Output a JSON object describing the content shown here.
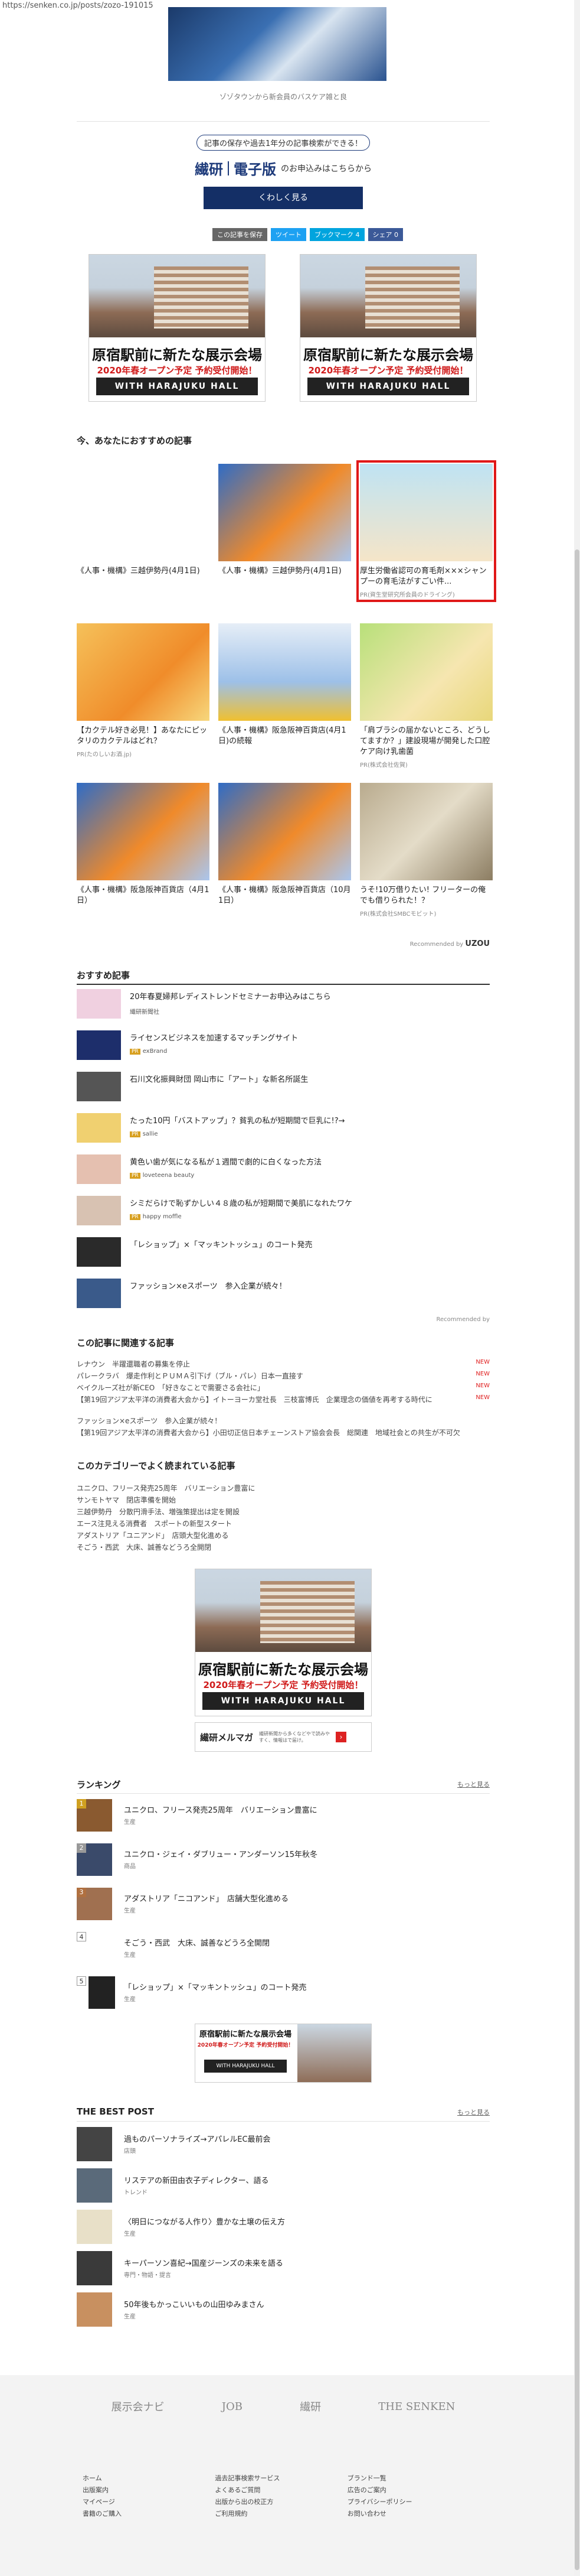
{
  "url": "https://senken.co.jp/posts/zozo-191015",
  "top_caption": "ゾゾタウンから新会員のバスケア雑と良",
  "subscribe": {
    "text": "記事の保存や過去1年分の記事検索ができる！",
    "logo": "繊研",
    "logo2": "電子版",
    "logo_suffix": "のお申込みはこちらから",
    "button": "くわしく見る"
  },
  "share": [
    "この記事を保存",
    "ツイート",
    "ブックマーク 4",
    "シェア 0"
  ],
  "ad": {
    "title": "原宿駅前に新たな展示会場",
    "sub": "2020年春オープン予定 予約受付開始！",
    "footer": "WITH HARAJUKU HALL"
  },
  "recommend_title": "今、あなたにおすすめの記事",
  "cards": [
    {
      "title": "《人事・機構》三越伊勢丹(4月1日)",
      "pr": ""
    },
    {
      "title": "《人事・機構》三越伊勢丹(4月1日)",
      "pr": ""
    },
    {
      "title": "厚生労働省認可の育毛剤×××シャンプーの育毛法がすごい件...",
      "pr": "PR(資生堂研究所会員のドライング)"
    },
    {
      "title": "【カクテル好き必見！】あなたにピッタリのカクテルはどれ？",
      "pr": "PR(たのしいお酒.jp)"
    },
    {
      "title": "《人事・機構》阪急阪神百貨店(4月1日)の続報",
      "pr": ""
    },
    {
      "title": "「肩ブラシの届かないところ、どうしてますか？」建設現場が開発した口腔ケア向け乳歯菌",
      "pr": "PR(株式会社佐賀)"
    },
    {
      "title": "《人事・機構》阪急阪神百貨店（4月1日）",
      "pr": ""
    },
    {
      "title": "《人事・機構》阪急阪神百貨店（10月1日）",
      "pr": ""
    },
    {
      "title": "うそ!10万借りたい! フリーターの俺でも借りられた！？",
      "pr": "PR(株式会社SMBCモビット)"
    }
  ],
  "powered": "Recommended by",
  "uzou": "UZOU",
  "osusume_title": "おすすめ記事",
  "osusume": [
    {
      "title": "20年春夏婦邦レディストレンドセミナーお申込みはこちら",
      "src": "繊研新聞社",
      "pr": false
    },
    {
      "title": "ライセンスビジネスを加速するマッチングサイト",
      "src": "exBrand",
      "pr": true
    },
    {
      "title": "石川文化振興財団 岡山市に「アート」な新名所誕生",
      "src": "",
      "pr": false
    },
    {
      "title": "たった10円「バストアップ」？貧乳の私が短期間で巨乳に!?→",
      "src": "sallie",
      "pr": true
    },
    {
      "title": "黄色い歯が気になる私が１週間で劇的に白くなった方法",
      "src": "loveteena beauty",
      "pr": true
    },
    {
      "title": "シミだらけで恥ずかしい４８歳の私が短期間で美肌になれたワケ",
      "src": "happy moffle",
      "pr": true
    },
    {
      "title": "「レショップ」×「マッキントッシュ」のコート発売",
      "src": "",
      "pr": false
    },
    {
      "title": "ファッション×eスポーツ　参入企業が続々！",
      "src": "",
      "pr": false
    }
  ],
  "recby2": "Recommended by",
  "related_title": "この記事に関連する記事",
  "related": [
    {
      "t": "レナウン　半躍還職者の募集を停止",
      "n": "NEW"
    },
    {
      "t": "パレークラバ　爆走作利とＰＵＭＡ引下げ（ブル・パレ）日本一直接す",
      "n": "NEW"
    },
    {
      "t": "ベイクルーズ社が新CEO　「好きなことで需要さる会社に」",
      "n": "NEW"
    },
    {
      "t": "【第19回アジア太平洋の消費者大会から】イトーヨーカ堂社長　三枝富博氏　企業理念の価値を再考する時代に",
      "n": "NEW"
    },
    {
      "t": "ファッション×eスポーツ　参入企業が続々！",
      "n": ""
    },
    {
      "t": "【第19回アジア太平洋の消費者大会から】小田切正信日本チェーンストア協会会長　総関連　地域社会との共生が不可欠",
      "n": ""
    }
  ],
  "category_title": "このカテゴリーでよく読まれている記事",
  "category": [
    "ユニクロ、フリース発売25周年　バリエーション豊富に",
    "サンモトヤマ　閉店準備を開始",
    "三越伊勢丹　分散円滑手法、増強策提出は定を開設",
    "エース注見える消費者　スポートの新型スタート",
    "アダストリア「ユニアンド」　店頭大型化進める",
    "そごう・西武　大床、誠善などうろ全開閉"
  ],
  "senken_mag": "繊研メルマガ",
  "mag_text": "繊研新聞から多くなどやで読みやすく、情報はで届け。",
  "ranking_title": "ランキング",
  "more": "もっと見る",
  "ranking": [
    {
      "no": "1",
      "t": "ユニクロ、フリース発売25周年　バリエーション豊富に",
      "s": "生産"
    },
    {
      "no": "2",
      "t": "ユニクロ・ジェイ・ダブリュー・アンダーソン15年秋冬",
      "s": "商品"
    },
    {
      "no": "3",
      "t": "アダストリア「ニコアンド」　店舗大型化進める",
      "s": "生産"
    },
    {
      "no": "4",
      "t": "そごう・西武　大床、誠善などうろ全開閉",
      "s": "生産"
    },
    {
      "no": "5",
      "t": "「レショップ」×「マッキントッシュ」のコート発売",
      "s": "生産"
    }
  ],
  "bestpost_title": "THE BEST POST",
  "bestpost": [
    {
      "t": "過ものパーソナライズ→アパレルEC最前会",
      "s": "店頭"
    },
    {
      "t": "リステアの新田由衣子ディレクター、語る",
      "s": "トレンド"
    },
    {
      "t": "〈明日につながる人作り〉豊かな土壌の伝え方",
      "s": "生産"
    },
    {
      "t": "キーパーソン喜紀→国産ジーンズの未来を語る",
      "s": "専門・物語・提言"
    },
    {
      "t": "50年後もかっこいいもの山田ゆみまさん",
      "s": "生産"
    }
  ],
  "footer": {
    "logos": [
      "展示会ナビ",
      "JOB",
      "繊研",
      "THE SENKEN"
    ],
    "col1": [
      "ホーム",
      "出版案内",
      "マイページ",
      "書籍のご購入"
    ],
    "col2": [
      "過去記事検索サービス",
      "よくあるご質問",
      "出版から出の校正方",
      "ご利用規約"
    ],
    "col3": [
      "ブランド一覧",
      "広告のご案内",
      "プライバシーポリシー",
      "お問い合わせ"
    ]
  }
}
